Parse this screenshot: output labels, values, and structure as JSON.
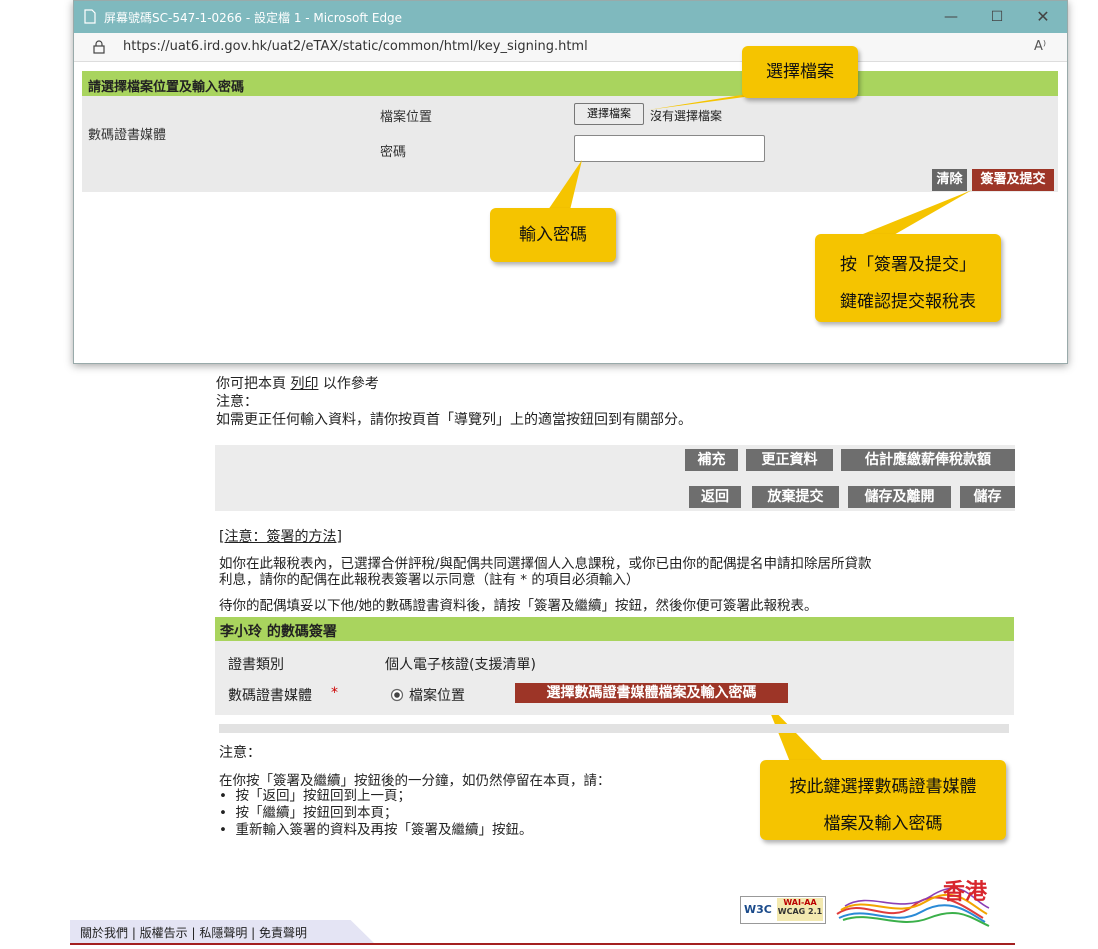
{
  "window": {
    "title": "屏幕號碼SC-547-1-0266 - 設定檔 1 - Microsoft Edge",
    "url": "https://uat6.ird.gov.hk/uat2/eTAX/static/common/html/key_signing.html",
    "read_aloud": "A⁾"
  },
  "popup": {
    "header": "請選擇檔案位置及輸入密碼",
    "media_label": "數碼證書媒體",
    "file_location_label": "檔案位置",
    "choose_file": "選擇檔案",
    "no_file": "沒有選擇檔案",
    "password_label": "密碼",
    "clear": "清除",
    "sign_submit": "簽署及提交"
  },
  "callouts": {
    "choose_file": "選擇檔案",
    "enter_password": "輸入密碼",
    "submit_line1": "按「簽署及提交」",
    "submit_line2": "鍵確認提交報稅表",
    "media_line1": "按此鍵選擇數碼證書媒體",
    "media_line2": "檔案及輸入密碼"
  },
  "page": {
    "print_pre": "你可把本頁",
    "print_link": "列印",
    "print_post": "以作參考",
    "note1_title": "注意：",
    "note1_text": "如需更正任何輸入資料，請你按頁首「導覽列」上的適當按鈕回到有關部分。",
    "buttons_row1": [
      "補充",
      "更正資料",
      "估計應繳薪俸稅款額"
    ],
    "buttons_row2": [
      "返回",
      "放棄提交",
      "儲存及離開",
      "儲存"
    ],
    "sign_method_link": "[注意：簽署的方法]",
    "para1_line1": "如你在此報稅表內，已選擇合併評稅/與配偶共同選擇個人入息課稅，或你已由你的配偶提名申請扣除居所貸款",
    "para1_line2": "利息，請你的配偶在此報稅表簽署以示同意（註有 * 的項目必須輸入）",
    "para2": "待你的配偶填妥以下他/她的數碼證書資料後，請按「簽署及繼續」按鈕，然後你便可簽署此報稅表。",
    "sig_header": "李小玲 的數碼簽署",
    "cert_type_label": "證書類別",
    "cert_type_value": "個人電子核證(支援清單)",
    "media_label": "數碼證書媒體",
    "required_mark": "*",
    "radio_label": "檔案位置",
    "select_media_button": "選擇數碼證書媒體檔案及輸入密碼",
    "note2_title": "注意：",
    "note2_intro": "在你按「簽署及繼續」按鈕後的一分鐘，如仍然停留在本頁，請：",
    "note2_items": [
      "按「返回」按鈕回到上一頁；",
      "按「繼續」按鈕回到本頁；",
      "重新輸入簽署的資料及再按「簽署及繼續」按鈕。"
    ],
    "w3c": "W3C",
    "wai_line1": "WAI-AA",
    "wai_line2": "WCAG 2.1",
    "hk_logo": "香港",
    "footer": "關於我們 | 版權告示 | 私隱聲明 | 免責聲明"
  }
}
